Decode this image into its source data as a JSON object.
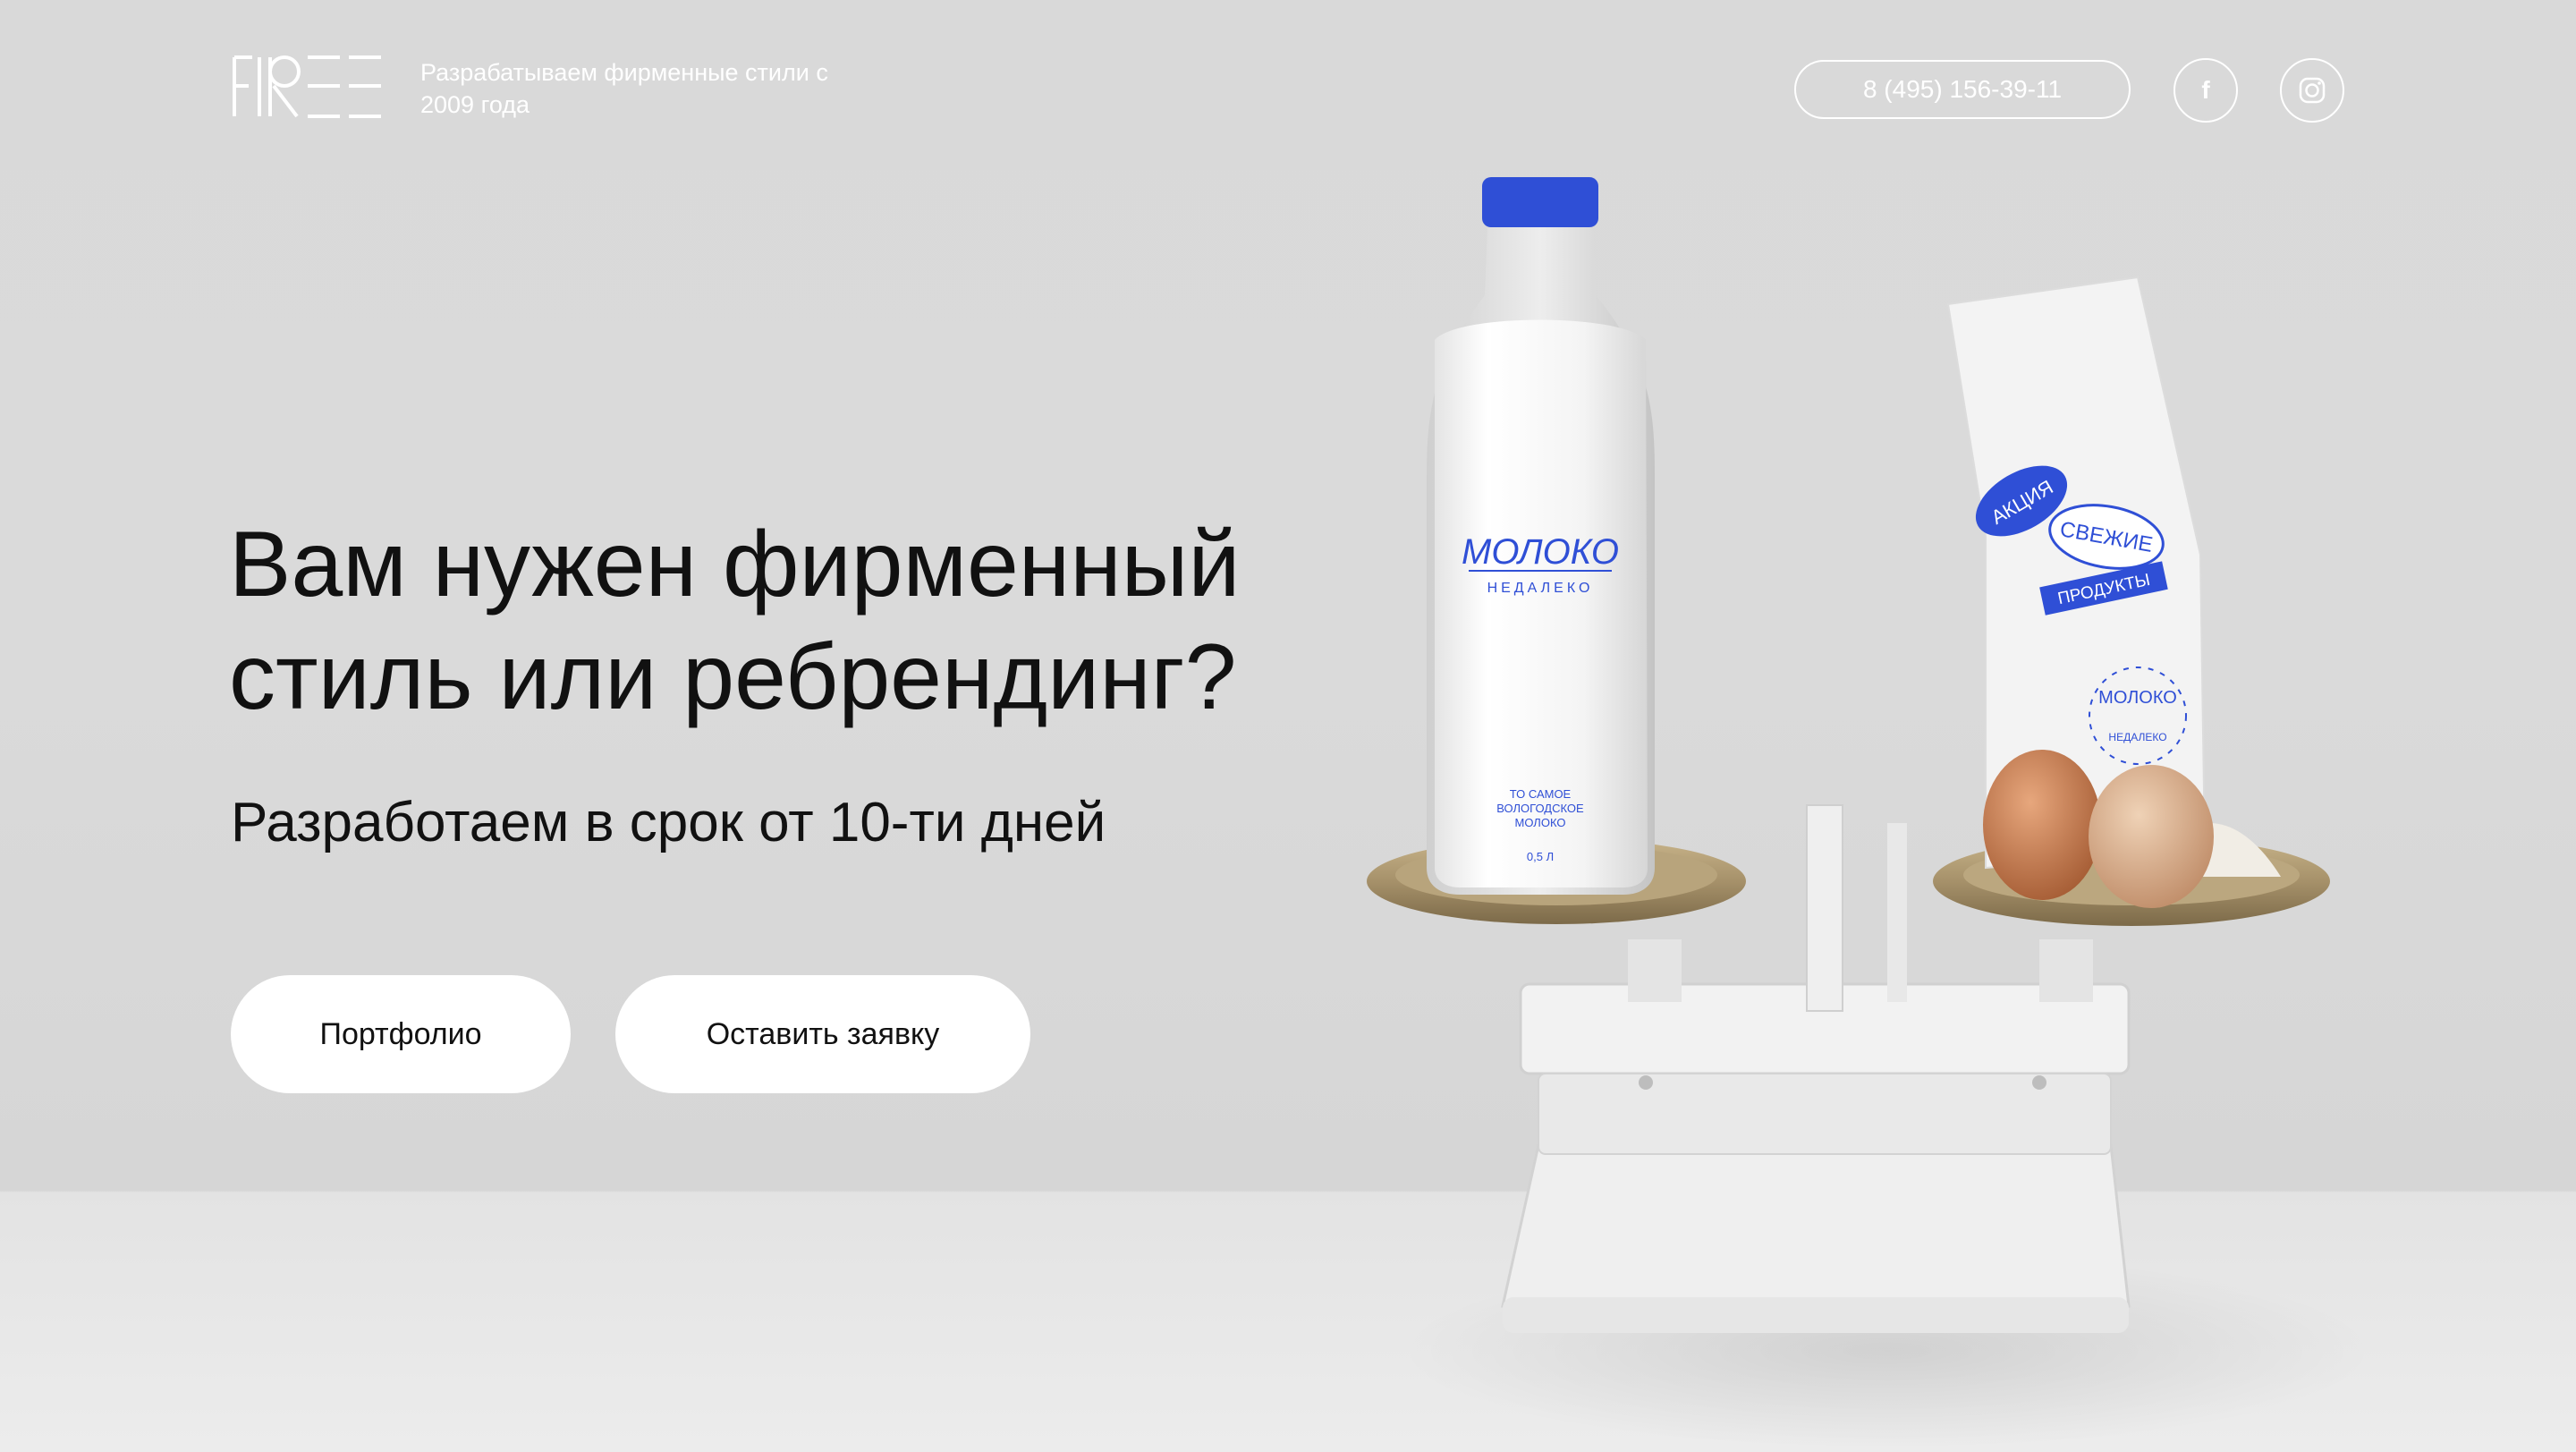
{
  "header": {
    "logo_text": "FREE",
    "tagline": "Разрабатываем фирменные стили с 2009 года",
    "phone": "8 (495) 156-39-11",
    "social": [
      {
        "name": "facebook",
        "icon": "facebook-icon",
        "glyph": "f"
      },
      {
        "name": "instagram",
        "icon": "instagram-icon"
      }
    ]
  },
  "hero": {
    "headline": "Вам нужен фирменный стиль или ребрендинг?",
    "subheadline": "Разработаем в срок от 10-ти дней",
    "buttons": {
      "portfolio": "Портфолио",
      "request": "Оставить заявку"
    }
  },
  "product_photo": {
    "bottle_brand": "МОЛОКО",
    "bottle_sub": "НЕДАЛЕКО",
    "bottle_desc_1": "ТО САМОЕ",
    "bottle_desc_2": "ВОЛОГОДСКОЕ",
    "bottle_desc_3": "МОЛОКО",
    "bottle_volume": "0,5 Л",
    "bag_sticker_1": "АКЦИЯ",
    "bag_sticker_2": "СВЕЖИЕ",
    "bag_sticker_3": "ПРОДУКТЫ",
    "bag_stamp_top": "МОЛОКО",
    "bag_stamp_bottom": "НЕДАЛЕКО"
  },
  "colors": {
    "accent": "#2f4fd6",
    "text": "#111111",
    "background": "#d9d9d9",
    "button_bg": "#ffffff"
  }
}
